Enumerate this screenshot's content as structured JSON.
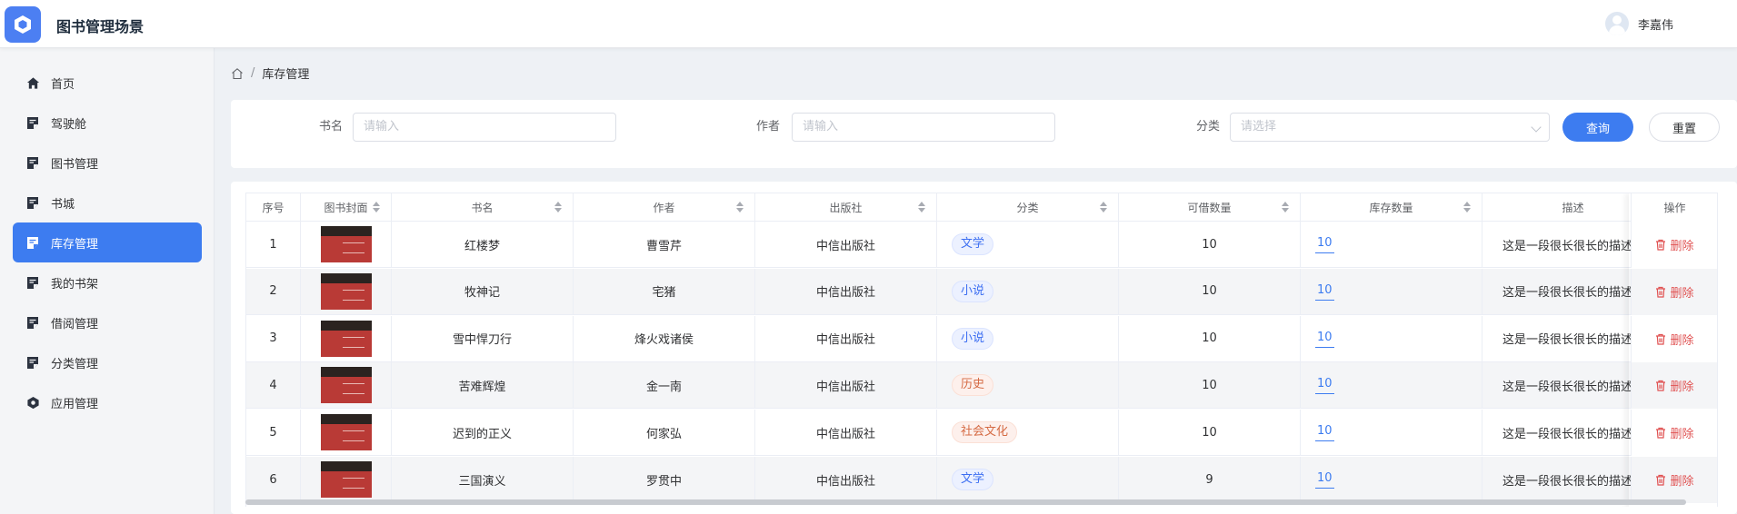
{
  "app": {
    "title": "图书管理场景"
  },
  "user": {
    "name": "李嘉伟"
  },
  "sidebar": {
    "items": [
      {
        "label": "首页",
        "icon": "home-icon",
        "active": false
      },
      {
        "label": "驾驶舱",
        "icon": "document-icon",
        "active": false
      },
      {
        "label": "图书管理",
        "icon": "document-icon",
        "active": false
      },
      {
        "label": "书城",
        "icon": "document-icon",
        "active": false
      },
      {
        "label": "库存管理",
        "icon": "document-icon",
        "active": true
      },
      {
        "label": "我的书架",
        "icon": "document-icon",
        "active": false
      },
      {
        "label": "借阅管理",
        "icon": "document-icon",
        "active": false
      },
      {
        "label": "分类管理",
        "icon": "document-icon",
        "active": false
      },
      {
        "label": "应用管理",
        "icon": "hexagon-icon",
        "active": false
      }
    ]
  },
  "breadcrumb": {
    "separator": "/",
    "current": "库存管理"
  },
  "search": {
    "name_label": "书名",
    "name_placeholder": "请输入",
    "author_label": "作者",
    "author_placeholder": "请输入",
    "category_label": "分类",
    "category_placeholder": "请选择",
    "query_button": "查询",
    "reset_button": "重置"
  },
  "table": {
    "columns": [
      "序号",
      "图书封面",
      "书名",
      "作者",
      "出版社",
      "分类",
      "可借数量",
      "库存数量",
      "描述",
      "操作"
    ],
    "rows": [
      {
        "index": "1",
        "title": "红楼梦",
        "author": "曹雪芹",
        "publisher": "中信出版社",
        "category": "文学",
        "category_color": "blue",
        "borrowable": "10",
        "stock": "10",
        "desc": "这是一段很长很长的描述",
        "action": "删除"
      },
      {
        "index": "2",
        "title": "牧神记",
        "author": "宅猪",
        "publisher": "中信出版社",
        "category": "小说",
        "category_color": "blue",
        "borrowable": "10",
        "stock": "10",
        "desc": "这是一段很长很长的描述",
        "action": "删除"
      },
      {
        "index": "3",
        "title": "雪中悍刀行",
        "author": "烽火戏诸侯",
        "publisher": "中信出版社",
        "category": "小说",
        "category_color": "blue",
        "borrowable": "10",
        "stock": "10",
        "desc": "这是一段很长很长的描述",
        "action": "删除"
      },
      {
        "index": "4",
        "title": "苦难辉煌",
        "author": "金一南",
        "publisher": "中信出版社",
        "category": "历史",
        "category_color": "orange",
        "borrowable": "10",
        "stock": "10",
        "desc": "这是一段很长很长的描述",
        "action": "删除"
      },
      {
        "index": "5",
        "title": "迟到的正义",
        "author": "何家弘",
        "publisher": "中信出版社",
        "category": "社会文化",
        "category_color": "orange",
        "borrowable": "10",
        "stock": "10",
        "desc": "这是一段很长很长的描述",
        "action": "删除"
      },
      {
        "index": "6",
        "title": "三国演义",
        "author": "罗贯中",
        "publisher": "中信出版社",
        "category": "文学",
        "category_color": "blue",
        "borrowable": "9",
        "stock": "10",
        "desc": "这是一段很长很长的描述",
        "action": "删除"
      }
    ]
  },
  "colors": {
    "primary": "#3d7cf0",
    "danger": "#e05252"
  }
}
